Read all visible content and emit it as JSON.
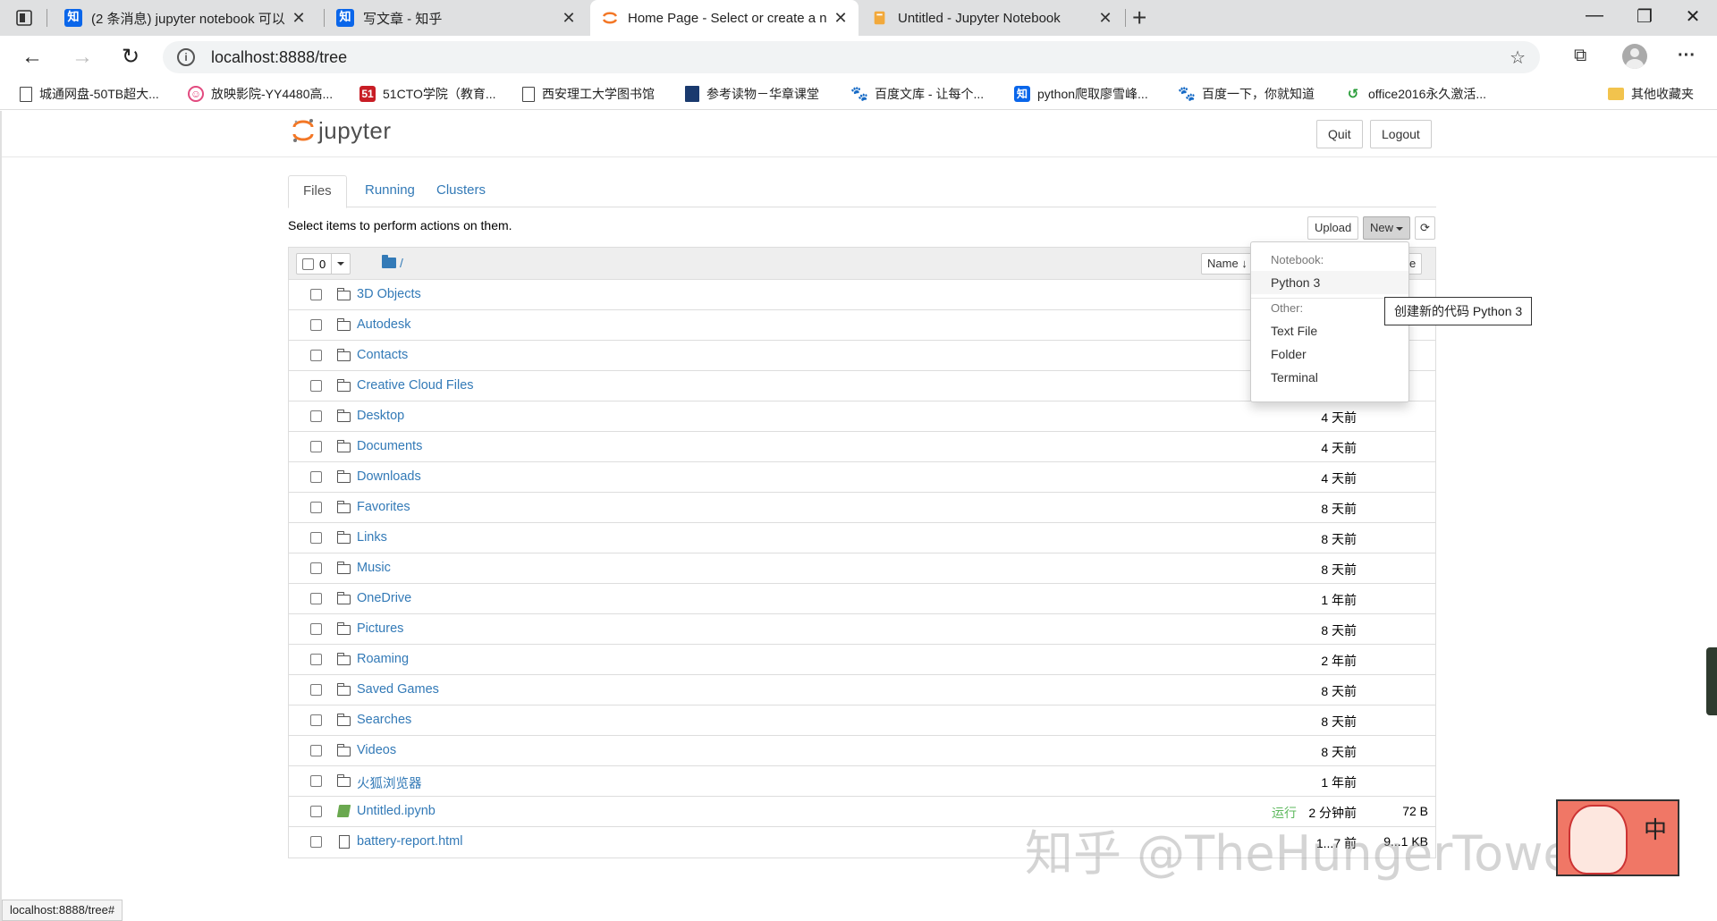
{
  "browser": {
    "tabs": [
      {
        "title": "(2 条消息) jupyter notebook 可以",
        "favicon": "知",
        "active": false
      },
      {
        "title": "写文章 - 知乎",
        "favicon": "知",
        "active": false
      },
      {
        "title": "Home Page - Select or create a n",
        "favicon": "jupyter",
        "active": true
      },
      {
        "title": "Untitled - Jupyter Notebook",
        "favicon": "book",
        "active": false
      }
    ],
    "url": "localhost:8888/tree",
    "bookmarks": [
      "城通网盘-50TB超大...",
      "放映影院-YY4480高...",
      "51CTO学院（教育...",
      "西安理工大学图书馆",
      "参考读物－华章课堂",
      "百度文库 - 让每个...",
      "python爬取廖雪峰...",
      "百度一下，你就知道",
      "office2016永久激活...",
      "其他收藏夹"
    ],
    "status_url": "localhost:8888/tree#"
  },
  "jupyter": {
    "logo_text": "jupyter",
    "quit": "Quit",
    "logout": "Logout",
    "tabs": [
      "Files",
      "Running",
      "Clusters"
    ],
    "hint": "Select items to perform actions on them.",
    "upload": "Upload",
    "new": "New",
    "selected_count": "0",
    "breadcrumb": "/",
    "sort_name": "Name ↓",
    "sort_last_visible": "e",
    "files": [
      {
        "name": "3D Objects",
        "type": "folder",
        "modified": "",
        "size": ""
      },
      {
        "name": "Autodesk",
        "type": "folder",
        "modified": "",
        "size": ""
      },
      {
        "name": "Contacts",
        "type": "folder",
        "modified": "",
        "size": ""
      },
      {
        "name": "Creative Cloud Files",
        "type": "folder",
        "modified": "",
        "size": ""
      },
      {
        "name": "Desktop",
        "type": "folder",
        "modified": "4 天前",
        "size": ""
      },
      {
        "name": "Documents",
        "type": "folder",
        "modified": "4 天前",
        "size": ""
      },
      {
        "name": "Downloads",
        "type": "folder",
        "modified": "4 天前",
        "size": ""
      },
      {
        "name": "Favorites",
        "type": "folder",
        "modified": "8 天前",
        "size": ""
      },
      {
        "name": "Links",
        "type": "folder",
        "modified": "8 天前",
        "size": ""
      },
      {
        "name": "Music",
        "type": "folder",
        "modified": "8 天前",
        "size": ""
      },
      {
        "name": "OneDrive",
        "type": "folder",
        "modified": "1 年前",
        "size": ""
      },
      {
        "name": "Pictures",
        "type": "folder",
        "modified": "8 天前",
        "size": ""
      },
      {
        "name": "Roaming",
        "type": "folder",
        "modified": "2 年前",
        "size": ""
      },
      {
        "name": "Saved Games",
        "type": "folder",
        "modified": "8 天前",
        "size": ""
      },
      {
        "name": "Searches",
        "type": "folder",
        "modified": "8 天前",
        "size": ""
      },
      {
        "name": "Videos",
        "type": "folder",
        "modified": "8 天前",
        "size": ""
      },
      {
        "name": "火狐浏览器",
        "type": "folder",
        "modified": "1 年前",
        "size": ""
      },
      {
        "name": "Untitled.ipynb",
        "type": "notebook",
        "running": "运行",
        "modified": "2 分钟前",
        "size": "72 B"
      },
      {
        "name": "battery-report.html",
        "type": "file",
        "modified": "1...7 前",
        "size": "9...1 KB"
      }
    ],
    "new_menu": {
      "notebook_header": "Notebook:",
      "python3": "Python 3",
      "other_header": "Other:",
      "text_file": "Text File",
      "folder": "Folder",
      "terminal": "Terminal"
    },
    "tooltip": "创建新的代码 Python 3"
  },
  "overlay": {
    "watermark": "知乎 @TheHungerTowerMM",
    "sticker_char": "中"
  },
  "colors": {
    "link": "#337ab7",
    "running": "#5cb85c",
    "jupyter_orange": "#f37726"
  }
}
